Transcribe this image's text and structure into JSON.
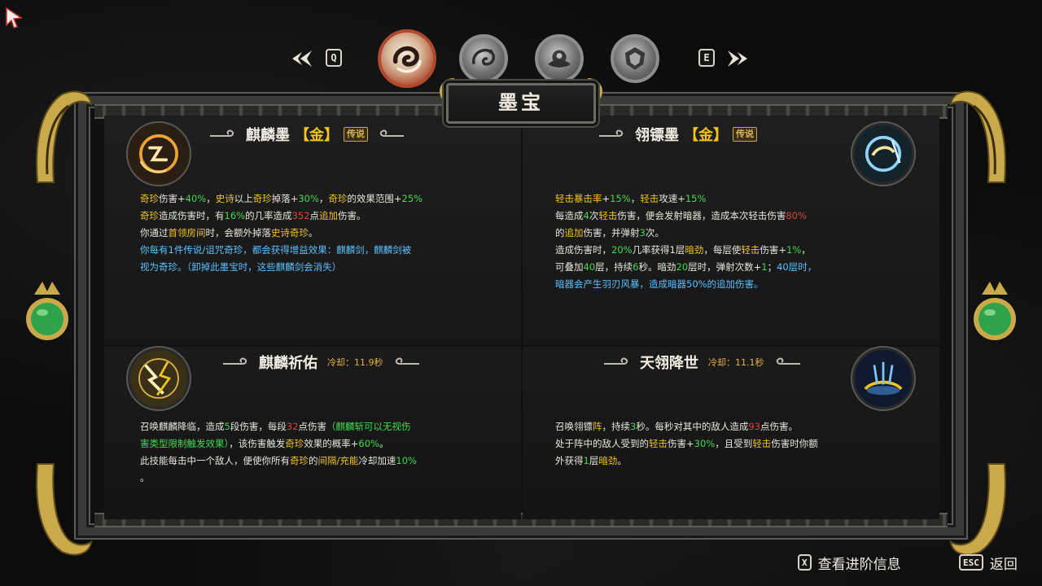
{
  "window_title": "墨宝",
  "nav": {
    "prev_key": "Q",
    "next_key": "E",
    "tabs": [
      {
        "icon": "ink-swirl-icon",
        "active": true
      },
      {
        "icon": "dragon-coil-icon",
        "active": false
      },
      {
        "icon": "lotus-emblem-icon",
        "active": false
      },
      {
        "icon": "armor-crest-icon",
        "active": false
      }
    ]
  },
  "items": [
    {
      "name": "麒麟墨",
      "grade_open": "【",
      "grade": "金",
      "grade_close": "】",
      "badge": "传说",
      "icon": "qilin-ink-icon",
      "lines": [
        [
          {
            "t": "奇珍",
            "c": "y"
          },
          {
            "t": "伤害+"
          },
          {
            "t": "40%",
            "c": "g"
          },
          {
            "t": "，"
          },
          {
            "t": "史诗",
            "c": "y"
          },
          {
            "t": "以上"
          },
          {
            "t": "奇珍",
            "c": "y"
          },
          {
            "t": "掉落+"
          },
          {
            "t": "30%",
            "c": "g"
          },
          {
            "t": "，"
          },
          {
            "t": "奇珍",
            "c": "y"
          },
          {
            "t": "的效果范围+"
          },
          {
            "t": "25%",
            "c": "g"
          }
        ],
        [
          {
            "t": "奇珍",
            "c": "y"
          },
          {
            "t": "造成伤害时，有"
          },
          {
            "t": "16%",
            "c": "g"
          },
          {
            "t": "的几率造成"
          },
          {
            "t": "352",
            "c": "r"
          },
          {
            "t": "点"
          },
          {
            "t": "追加",
            "c": "y"
          },
          {
            "t": "伤害。"
          }
        ],
        [
          {
            "t": "你通过"
          },
          {
            "t": "首领房间",
            "c": "y"
          },
          {
            "t": "时，会额外掉落"
          },
          {
            "t": "史诗奇珍",
            "c": "y"
          },
          {
            "t": "。"
          }
        ],
        [
          {
            "t": "你每有1件传说/诅咒奇珍，都会获得增益效果：麒麟剑，麒麟剑被",
            "c": "c"
          }
        ],
        [
          {
            "t": "视为奇珍。（卸掉此墨宝时，这些麒麟剑会消失）",
            "c": "c"
          }
        ]
      ]
    },
    {
      "name": "翎镖墨",
      "grade_open": "【",
      "grade": "金",
      "grade_close": "】",
      "badge": "传说",
      "icon": "feather-dart-ink-icon",
      "lines": [
        [
          {
            "t": "轻击暴击率",
            "c": "y"
          },
          {
            "t": "+"
          },
          {
            "t": "15%",
            "c": "g"
          },
          {
            "t": "，"
          },
          {
            "t": "轻击",
            "c": "y"
          },
          {
            "t": "攻速+"
          },
          {
            "t": "15%",
            "c": "g"
          }
        ],
        [
          {
            "t": "每造成"
          },
          {
            "t": "4",
            "c": "g"
          },
          {
            "t": "次"
          },
          {
            "t": "轻击",
            "c": "y"
          },
          {
            "t": "伤害，便会发射暗器，造成本次轻击伤害"
          },
          {
            "t": "80%",
            "c": "r"
          }
        ],
        [
          {
            "t": "的"
          },
          {
            "t": "追加",
            "c": "y"
          },
          {
            "t": "伤害，并弹射"
          },
          {
            "t": "3",
            "c": "g"
          },
          {
            "t": "次。"
          }
        ],
        [
          {
            "t": "造成伤害时，"
          },
          {
            "t": "20%",
            "c": "g"
          },
          {
            "t": "几率获得1层"
          },
          {
            "t": "暗劲",
            "c": "y"
          },
          {
            "t": "，每层使"
          },
          {
            "t": "轻击",
            "c": "y"
          },
          {
            "t": "伤害+"
          },
          {
            "t": "1%",
            "c": "g"
          },
          {
            "t": "，"
          }
        ],
        [
          {
            "t": "可叠加"
          },
          {
            "t": "40",
            "c": "g"
          },
          {
            "t": "层，持续"
          },
          {
            "t": "6",
            "c": "g"
          },
          {
            "t": "秒。暗劲"
          },
          {
            "t": "20",
            "c": "g"
          },
          {
            "t": "层时，弹射次数+"
          },
          {
            "t": "1",
            "c": "g"
          },
          {
            "t": "；"
          },
          {
            "t": "40层时，",
            "c": "c"
          }
        ],
        [
          {
            "t": "暗器会产生羽刃风暴，造成暗器50%的追加伤害。",
            "c": "c"
          }
        ]
      ]
    }
  ],
  "skills": [
    {
      "name": "麒麟祈佑",
      "cooldown": "冷却：11.9秒",
      "icon": "qilin-blessing-icon",
      "lines": [
        [
          {
            "t": "召唤麒麟降临，造成"
          },
          {
            "t": "5",
            "c": "g"
          },
          {
            "t": "段伤害，每段"
          },
          {
            "t": "32",
            "c": "r"
          },
          {
            "t": "点伤害"
          },
          {
            "t": "（麒麟斩可以无视伤",
            "c": "g"
          }
        ],
        [
          {
            "t": "害类型限制触发效果）",
            "c": "g"
          },
          {
            "t": "，该伤害触发"
          },
          {
            "t": "奇珍",
            "c": "y"
          },
          {
            "t": "效果的概率+"
          },
          {
            "t": "60%",
            "c": "g"
          },
          {
            "t": "。"
          }
        ],
        [
          {
            "t": "此技能每击中一个敌人，便使你所有"
          },
          {
            "t": "奇珍",
            "c": "y"
          },
          {
            "t": "的"
          },
          {
            "t": "间隔/充能",
            "c": "y"
          },
          {
            "t": "冷却加速"
          },
          {
            "t": "10%",
            "c": "g"
          }
        ],
        [
          {
            "t": "。"
          }
        ]
      ]
    },
    {
      "name": "天翎降世",
      "cooldown": "冷却：11.1秒",
      "icon": "feather-descent-icon",
      "lines": [
        [
          {
            "t": "召唤翎镖"
          },
          {
            "t": "阵",
            "c": "y"
          },
          {
            "t": "，持续"
          },
          {
            "t": "3",
            "c": "g"
          },
          {
            "t": "秒。每秒对其中的敌人造成"
          },
          {
            "t": "93",
            "c": "r"
          },
          {
            "t": "点伤害。"
          }
        ],
        [
          {
            "t": "处于阵中的敌人受到的"
          },
          {
            "t": "轻击",
            "c": "y"
          },
          {
            "t": "伤害+"
          },
          {
            "t": "30%",
            "c": "g"
          },
          {
            "t": "，且受到"
          },
          {
            "t": "轻击",
            "c": "y"
          },
          {
            "t": "伤害时你额"
          }
        ],
        [
          {
            "t": "外获得"
          },
          {
            "t": "1",
            "c": "g"
          },
          {
            "t": "层"
          },
          {
            "t": "暗劲",
            "c": "y"
          },
          {
            "t": "。"
          }
        ]
      ]
    }
  ],
  "footer": {
    "advanced_key": "X",
    "advanced_label": "查看进阶信息",
    "back_key": "ESC",
    "back_label": "返回"
  },
  "colors": {
    "highlight_yellow": "#f0c419",
    "highlight_green": "#3fdc4f",
    "highlight_red": "#e0403a",
    "highlight_cyan": "#5bc0ff",
    "frame_gold": "#c9a94a",
    "orb_green": "#2fa24a"
  }
}
